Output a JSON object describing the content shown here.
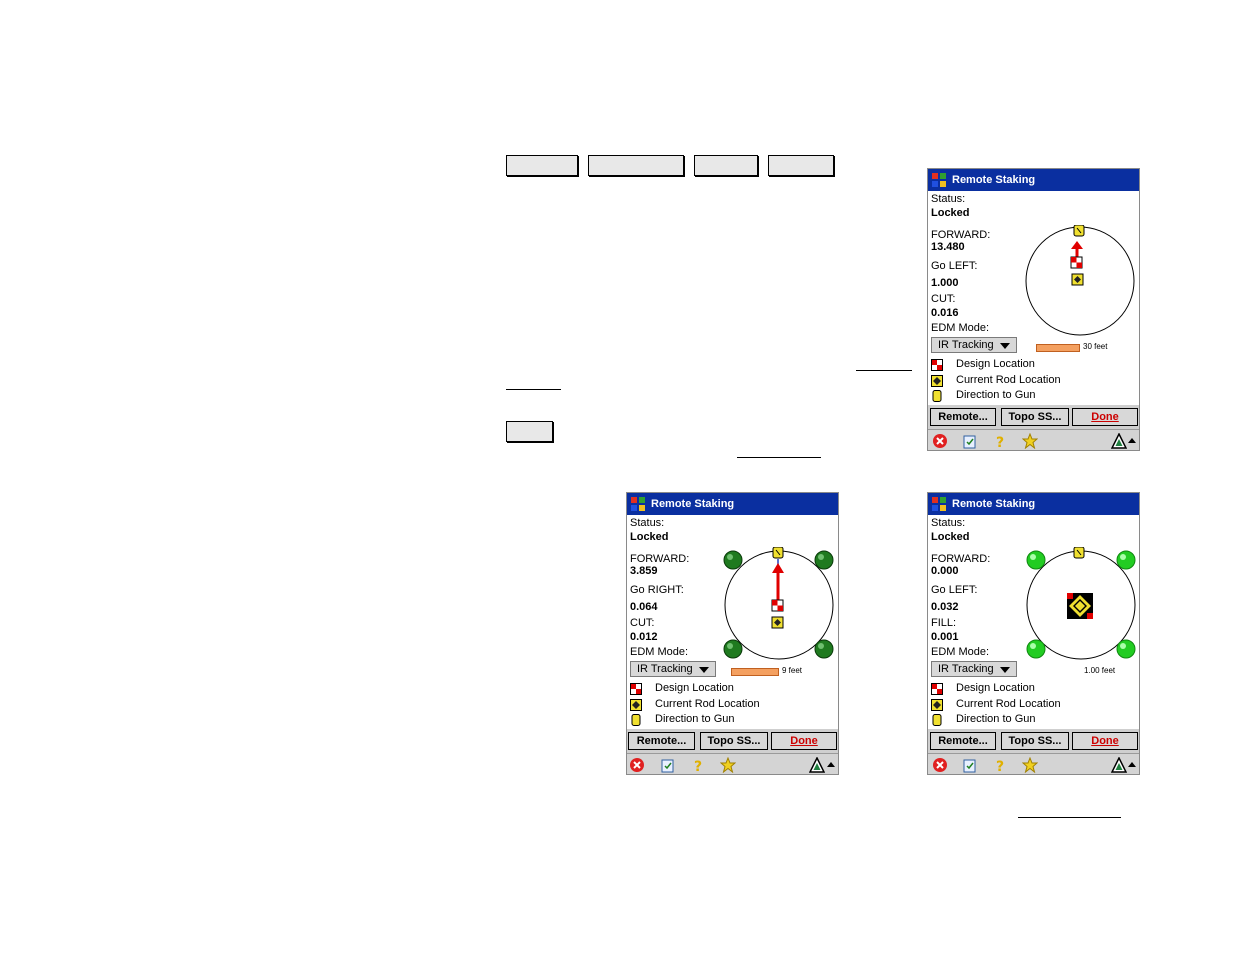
{
  "toolbar_buttons": [
    "",
    "",
    "",
    ""
  ],
  "small_button": "",
  "screens": [
    {
      "title": "Remote Staking",
      "status_label": "Status:",
      "status_value": "Locked",
      "dir1_label": "FORWARD:",
      "dir1_value": "13.480",
      "dir2_label": "Go LEFT:",
      "dir2_value": "1.000",
      "elev_label": "CUT:",
      "elev_value": "0.016",
      "edm_label": "EDM Mode:",
      "edm_value": "IR Tracking",
      "scale_label": "30 feet",
      "legend": [
        "Design Location",
        "Current Rod Location",
        "Direction to Gun"
      ],
      "buttons": [
        "Remote...",
        "Topo SS...",
        "Done"
      ],
      "on_target": false,
      "proximity_lights": false
    },
    {
      "title": "Remote Staking",
      "status_label": "Status:",
      "status_value": "Locked",
      "dir1_label": "FORWARD:",
      "dir1_value": "3.859",
      "dir2_label": "Go RIGHT:",
      "dir2_value": "0.064",
      "elev_label": "CUT:",
      "elev_value": "0.012",
      "edm_label": "EDM Mode:",
      "edm_value": "IR Tracking",
      "scale_label": "9 feet",
      "legend": [
        "Design Location",
        "Current Rod Location",
        "Direction to Gun"
      ],
      "buttons": [
        "Remote...",
        "Topo SS...",
        "Done"
      ],
      "on_target": false,
      "proximity_lights": true,
      "light_color": "#1f7a1f"
    },
    {
      "title": "Remote Staking",
      "status_label": "Status:",
      "status_value": "Locked",
      "dir1_label": "FORWARD:",
      "dir1_value": "0.000",
      "dir2_label": "Go LEFT:",
      "dir2_value": "0.032",
      "elev_label": "FILL:",
      "elev_value": "0.001",
      "edm_label": "EDM Mode:",
      "edm_value": "IR Tracking",
      "scale_label": "1.00 feet",
      "legend": [
        "Design Location",
        "Current Rod Location",
        "Direction to Gun"
      ],
      "buttons": [
        "Remote...",
        "Topo SS...",
        "Done"
      ],
      "on_target": true,
      "proximity_lights": true,
      "light_color": "#22cc22"
    }
  ],
  "colors": {
    "titlebar": "#0a2fa0",
    "arrow": "#e00000",
    "scale_bar": "#f4a060",
    "done_text": "#cc0000"
  },
  "icons": [
    "windows-flag-icon",
    "close-icon",
    "clipboard-icon",
    "help-icon",
    "star-icon",
    "survey-icon",
    "design-location-icon",
    "rod-location-icon",
    "gun-direction-icon"
  ]
}
